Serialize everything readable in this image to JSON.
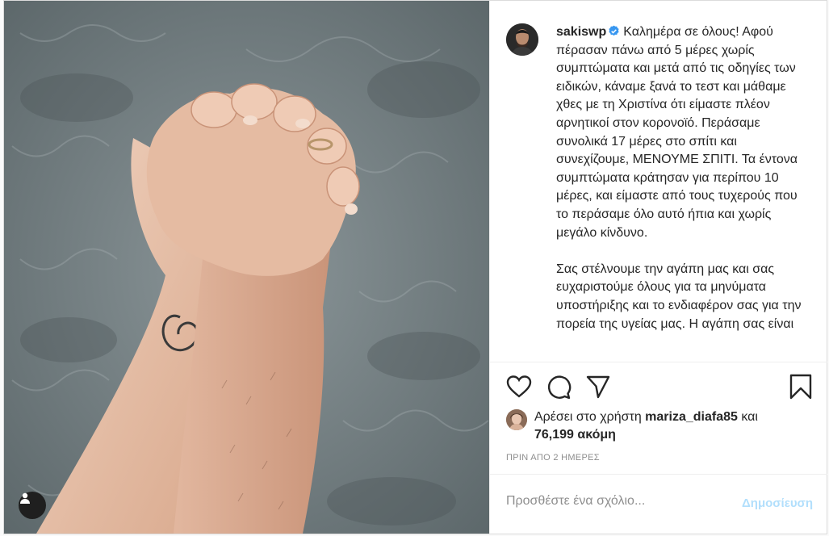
{
  "author": {
    "username": "sakiswp",
    "verified": true,
    "avatar_icon": "profile-avatar"
  },
  "caption": {
    "paragraph1": "Καλημέρα σε όλους! Αφού πέρασαν πάνω από 5 μέρες χωρίς συμπτώματα και μετά από τις οδηγίες των ειδικών, κάναμε ξανά το τεστ και μάθαμε χθες με τη Χριστίνα ότι είμαστε πλέον αρνητικοί στον κορονοϊό. Περάσαμε συνολικά 17 μέρες στο σπίτι και συνεχίζουμε, ΜΕΝΟΥΜΕ ΣΠΙΤΙ. Τα έντονα συμπτώματα κράτησαν για περίπου 10 μέρες, και είμαστε από τους τυχερούς που το περάσαμε όλο αυτό ήπια και χωρίς μεγάλο κίνδυνο.",
    "paragraph2": "Σας στέλνουμε την αγάπη μας και σας ευχαριστούμε όλους για τα μηνύματα υποστήριξης και το ενδιαφέρον σας για την πορεία της υγείας μας. Η αγάπη σας είναι"
  },
  "actions": {
    "like_icon": "heart-icon",
    "comment_icon": "comment-icon",
    "share_icon": "share-icon",
    "save_icon": "bookmark-icon"
  },
  "likes": {
    "prefix": "Αρέσει στο χρήστη",
    "user": "mariza_diafa85",
    "joiner": "και",
    "count": "76,199 ακόμη"
  },
  "timestamp": "ΠΡΙΝ ΑΠΟ 2 ΗΜΕΡΕΣ",
  "comment": {
    "placeholder": "Προσθέστε ένα σχόλιο...",
    "post_label": "Δημοσίευση"
  },
  "colors": {
    "verified": "#3897f0",
    "post_button_disabled": "#b2dffc",
    "muted": "#8e8e8e"
  }
}
